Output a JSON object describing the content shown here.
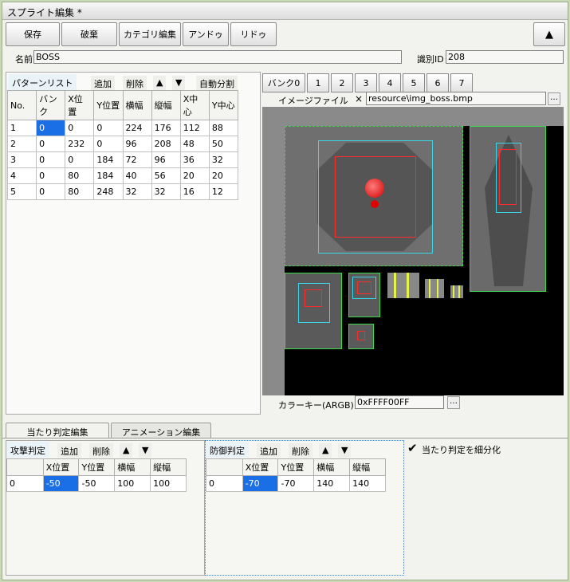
{
  "window": {
    "title": "スプライト編集 *"
  },
  "toolbar": {
    "save": "保存",
    "discard": "破棄",
    "category_edit": "カテゴリ編集",
    "undo": "アンドゥ",
    "redo": "リドゥ",
    "collapse_icon": "▲"
  },
  "sprite": {
    "name_label": "名前",
    "name_value": "BOSS",
    "id_label": "識別ID",
    "id_value": "208"
  },
  "pattern_list": {
    "tab": "パターンリスト",
    "add": "追加",
    "delete": "削除",
    "up_icon": "▲",
    "down_icon": "▼",
    "auto_split": "自動分割",
    "columns": [
      "No.",
      "バンク",
      "X位置",
      "Y位置",
      "横幅",
      "縦幅",
      "X中心",
      "Y中心"
    ],
    "rows": [
      [
        "1",
        "0",
        "0",
        "0",
        "224",
        "176",
        "112",
        "88"
      ],
      [
        "2",
        "0",
        "232",
        "0",
        "96",
        "208",
        "48",
        "50"
      ],
      [
        "3",
        "0",
        "0",
        "184",
        "72",
        "96",
        "36",
        "32"
      ],
      [
        "4",
        "0",
        "80",
        "184",
        "40",
        "56",
        "20",
        "20"
      ],
      [
        "5",
        "0",
        "80",
        "248",
        "32",
        "32",
        "16",
        "12"
      ]
    ]
  },
  "banks": {
    "labels": [
      "バンク0",
      "1",
      "2",
      "3",
      "4",
      "5",
      "6",
      "7"
    ],
    "image_file_label": "イメージファイル",
    "clear_icon": "×",
    "image_file_value": "resource\\img_boss.bmp",
    "browse": "…",
    "colorkey_label": "カラーキー(ARGB)",
    "colorkey_value": "0xFFFF00FF",
    "colorkey_browse": "…"
  },
  "bottom_tabs": {
    "hit_edit": "当たり判定編集",
    "anim_edit": "アニメーション編集"
  },
  "attack": {
    "tab": "攻撃判定",
    "add": "追加",
    "delete": "削除",
    "up_icon": "▲",
    "down_icon": "▼",
    "columns": [
      "",
      "X位置",
      "Y位置",
      "横幅",
      "縦幅"
    ],
    "rows": [
      [
        "0",
        "-50",
        "-50",
        "100",
        "100"
      ]
    ]
  },
  "defense": {
    "tab": "防御判定",
    "add": "追加",
    "delete": "削除",
    "up_icon": "▲",
    "down_icon": "▼",
    "columns": [
      "",
      "X位置",
      "Y位置",
      "横幅",
      "縦幅"
    ],
    "rows": [
      [
        "0",
        "-70",
        "-70",
        "140",
        "140"
      ]
    ]
  },
  "subdivide": {
    "label": "当たり判定を細分化",
    "checked": true,
    "check_icon": "✔"
  }
}
